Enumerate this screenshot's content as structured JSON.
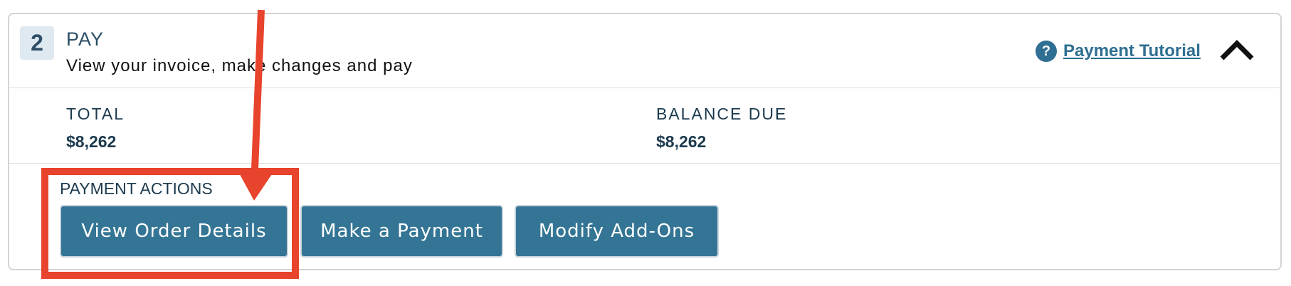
{
  "section": {
    "step_number": "2",
    "title": "PAY",
    "subtitle": "View your invoice, make changes and pay"
  },
  "help": {
    "icon_glyph": "?",
    "tutorial_link": "Payment Tutorial"
  },
  "summary": {
    "total_label": "TOTAL",
    "total_value": "$8,262",
    "balance_label": "BALANCE DUE",
    "balance_value": "$8,262"
  },
  "actions": {
    "label": "PAYMENT ACTIONS",
    "buttons": [
      {
        "label": "View Order Details"
      },
      {
        "label": "Make a Payment"
      },
      {
        "label": "Modify Add-Ons"
      }
    ]
  },
  "icons": {
    "help": "question-circle-icon",
    "collapse": "chevron-up-icon"
  },
  "colors": {
    "primary_button": "#347595",
    "link": "#2f6f93",
    "heading": "#2b4f66",
    "badge_bg": "#dfe9f0",
    "annotation": "#e8432c"
  }
}
